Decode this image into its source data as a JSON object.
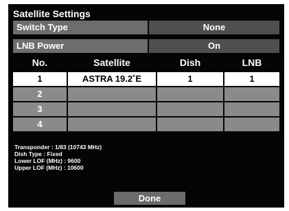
{
  "title": "Satellite Settings",
  "settings": [
    {
      "label": "Switch Type",
      "value": "None"
    },
    {
      "label": "LNB Power",
      "value": "On"
    }
  ],
  "table": {
    "headers": [
      "No.",
      "Satellite",
      "Dish",
      "LNB"
    ],
    "rows": [
      {
        "no": "1",
        "satellite": "ASTRA 19.2˚E",
        "dish": "1",
        "lnb": "1"
      },
      {
        "no": "2",
        "satellite": "",
        "dish": "",
        "lnb": ""
      },
      {
        "no": "3",
        "satellite": "",
        "dish": "",
        "lnb": ""
      },
      {
        "no": "4",
        "satellite": "",
        "dish": "",
        "lnb": ""
      }
    ]
  },
  "info": {
    "transponder": "Transponder : 1/83 (10743 MHz)",
    "dish_type": "Dish Type : Fixed",
    "lower_lof": "Lower LOF (MHz) : 9600",
    "upper_lof": "Upper LOF (MHz) : 10600"
  },
  "buttons": {
    "done": "Done"
  },
  "colors": {
    "background": "#050505",
    "selected_row": "#ffffff",
    "empty_row": "#8a8a8a",
    "label_cell": "#6d6d6d",
    "value_cell": "#4f4f4f"
  }
}
